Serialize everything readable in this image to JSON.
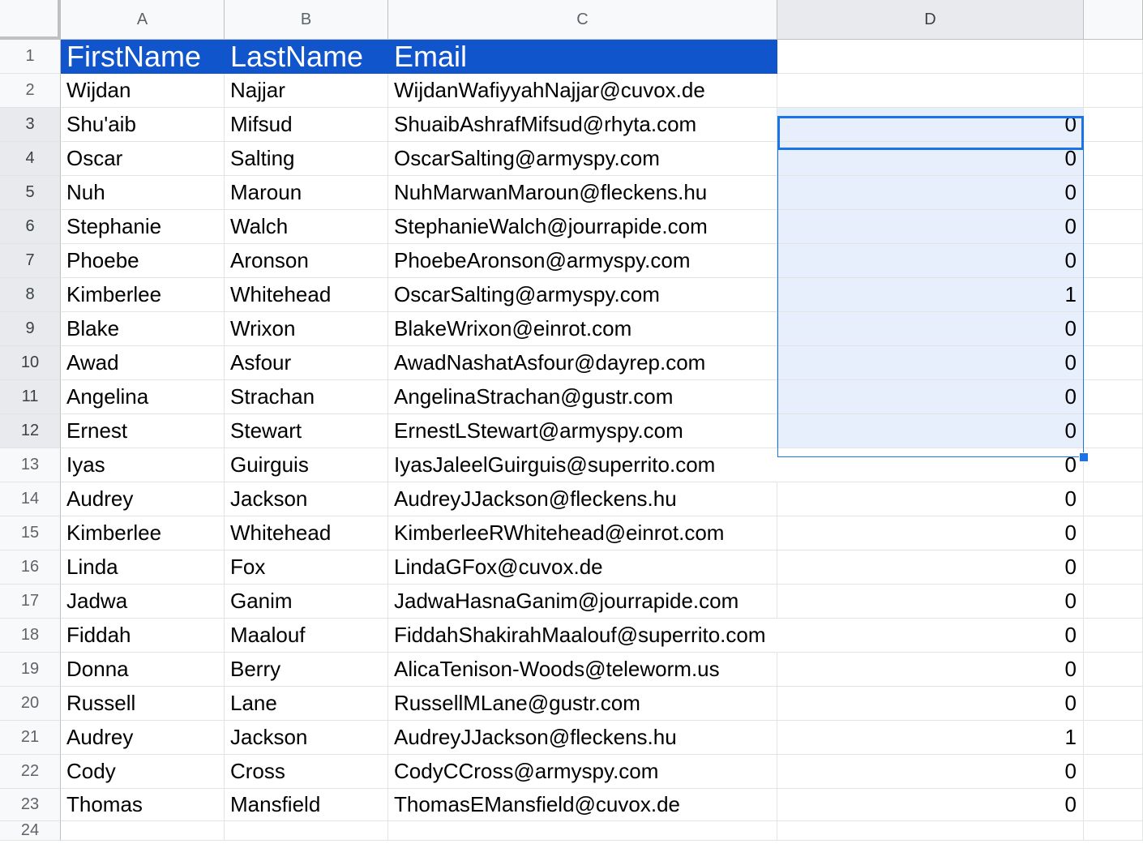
{
  "columns": [
    "A",
    "B",
    "C",
    "D"
  ],
  "header_row": {
    "row_number": "1",
    "first_name": "FirstName",
    "last_name": "LastName",
    "email": "Email"
  },
  "rows": [
    {
      "num": "2",
      "first": "Wijdan",
      "last": "Najjar",
      "email": "WijdanWafiyyahNajjar@cuvox.de",
      "d": ""
    },
    {
      "num": "3",
      "first": "Shu'aib",
      "last": "Mifsud",
      "email": "ShuaibAshrafMifsud@rhyta.com",
      "d": "0"
    },
    {
      "num": "4",
      "first": "Oscar",
      "last": "Salting",
      "email": "OscarSalting@armyspy.com",
      "d": "0"
    },
    {
      "num": "5",
      "first": "Nuh",
      "last": "Maroun",
      "email": "NuhMarwanMaroun@fleckens.hu",
      "d": "0"
    },
    {
      "num": "6",
      "first": "Stephanie",
      "last": "Walch",
      "email": "StephanieWalch@jourrapide.com",
      "d": "0"
    },
    {
      "num": "7",
      "first": "Phoebe",
      "last": "Aronson",
      "email": "PhoebeAronson@armyspy.com",
      "d": "0"
    },
    {
      "num": "8",
      "first": "Kimberlee",
      "last": "Whitehead",
      "email": "OscarSalting@armyspy.com",
      "d": "1"
    },
    {
      "num": "9",
      "first": "Blake",
      "last": "Wrixon",
      "email": "BlakeWrixon@einrot.com",
      "d": "0"
    },
    {
      "num": "10",
      "first": "Awad",
      "last": "Asfour",
      "email": "AwadNashatAsfour@dayrep.com",
      "d": "0"
    },
    {
      "num": "11",
      "first": "Angelina",
      "last": "Strachan",
      "email": "AngelinaStrachan@gustr.com",
      "d": "0"
    },
    {
      "num": "12",
      "first": "Ernest",
      "last": "Stewart",
      "email": "ErnestLStewart@armyspy.com",
      "d": "0"
    },
    {
      "num": "13",
      "first": "Iyas",
      "last": "Guirguis",
      "email": "IyasJaleelGuirguis@superrito.com",
      "d": "0"
    },
    {
      "num": "14",
      "first": "Audrey",
      "last": "Jackson",
      "email": "AudreyJJackson@fleckens.hu",
      "d": "0"
    },
    {
      "num": "15",
      "first": "Kimberlee",
      "last": "Whitehead",
      "email": "KimberleeRWhitehead@einrot.com",
      "d": "0"
    },
    {
      "num": "16",
      "first": "Linda",
      "last": "Fox",
      "email": "LindaGFox@cuvox.de",
      "d": "0"
    },
    {
      "num": "17",
      "first": "Jadwa",
      "last": "Ganim",
      "email": "JadwaHasnaGanim@jourrapide.com",
      "d": "0"
    },
    {
      "num": "18",
      "first": "Fiddah",
      "last": "Maalouf",
      "email": "FiddahShakirahMaalouf@superrito.com",
      "d": "0"
    },
    {
      "num": "19",
      "first": "Donna",
      "last": "Berry",
      "email": "AlicaTenison-Woods@teleworm.us",
      "d": "0"
    },
    {
      "num": "20",
      "first": "Russell",
      "last": "Lane",
      "email": "RussellMLane@gustr.com",
      "d": "0"
    },
    {
      "num": "21",
      "first": "Audrey",
      "last": "Jackson",
      "email": "AudreyJJackson@fleckens.hu",
      "d": "1"
    },
    {
      "num": "22",
      "first": "Cody",
      "last": "Cross",
      "email": "CodyCCross@armyspy.com",
      "d": "0"
    },
    {
      "num": "23",
      "first": "Thomas",
      "last": "Mansfield",
      "email": "ThomasEMansfield@cuvox.de",
      "d": "0"
    }
  ],
  "last_row_number": "24",
  "colors": {
    "header_fill": "#1155cc",
    "selection_fill": "#e7effd",
    "selection_border": "#1a73e8"
  }
}
